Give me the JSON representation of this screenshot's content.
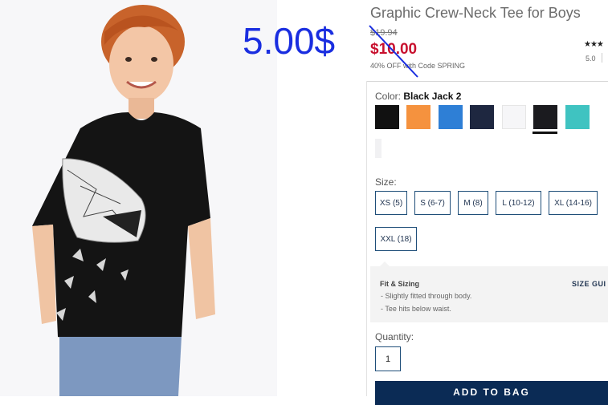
{
  "annotation": {
    "handwritten_price": "5.00$"
  },
  "product": {
    "title": "Graphic Crew-Neck Tee for Boys",
    "old_price": "$19.94",
    "sale_price": "$10.00",
    "promo": "40% OFF with Code SPRING",
    "rating_stars": "★★★",
    "rating_value": "5.0"
  },
  "color": {
    "label": "Color:",
    "selected": "Black Jack 2",
    "swatches": [
      {
        "name": "black",
        "hex": "#111111"
      },
      {
        "name": "orange",
        "hex": "#f5923e"
      },
      {
        "name": "blue",
        "hex": "#2e7fd6"
      },
      {
        "name": "navy",
        "hex": "#1e2740"
      },
      {
        "name": "white",
        "hex": "#f6f6f8"
      },
      {
        "name": "black-jack-2",
        "hex": "#1b1b1f"
      },
      {
        "name": "teal",
        "hex": "#3fc3c1"
      }
    ]
  },
  "size": {
    "label": "Size:",
    "options": [
      "XS (5)",
      "S (6-7)",
      "M (8)",
      "L (10-12)",
      "XL (14-16)",
      "XXL (18)"
    ]
  },
  "fit": {
    "title": "Fit & Sizing",
    "size_guide": "SIZE GUI",
    "lines": [
      "- Slightly fitted through body.",
      "- Tee hits below waist."
    ]
  },
  "quantity": {
    "label": "Quantity:",
    "value": "1"
  },
  "cta": {
    "add_to_bag": "ADD TO BAG"
  },
  "colors": {
    "accent": "#0b2b55",
    "sale": "#c8102e",
    "annotation": "#1a2ee0"
  }
}
